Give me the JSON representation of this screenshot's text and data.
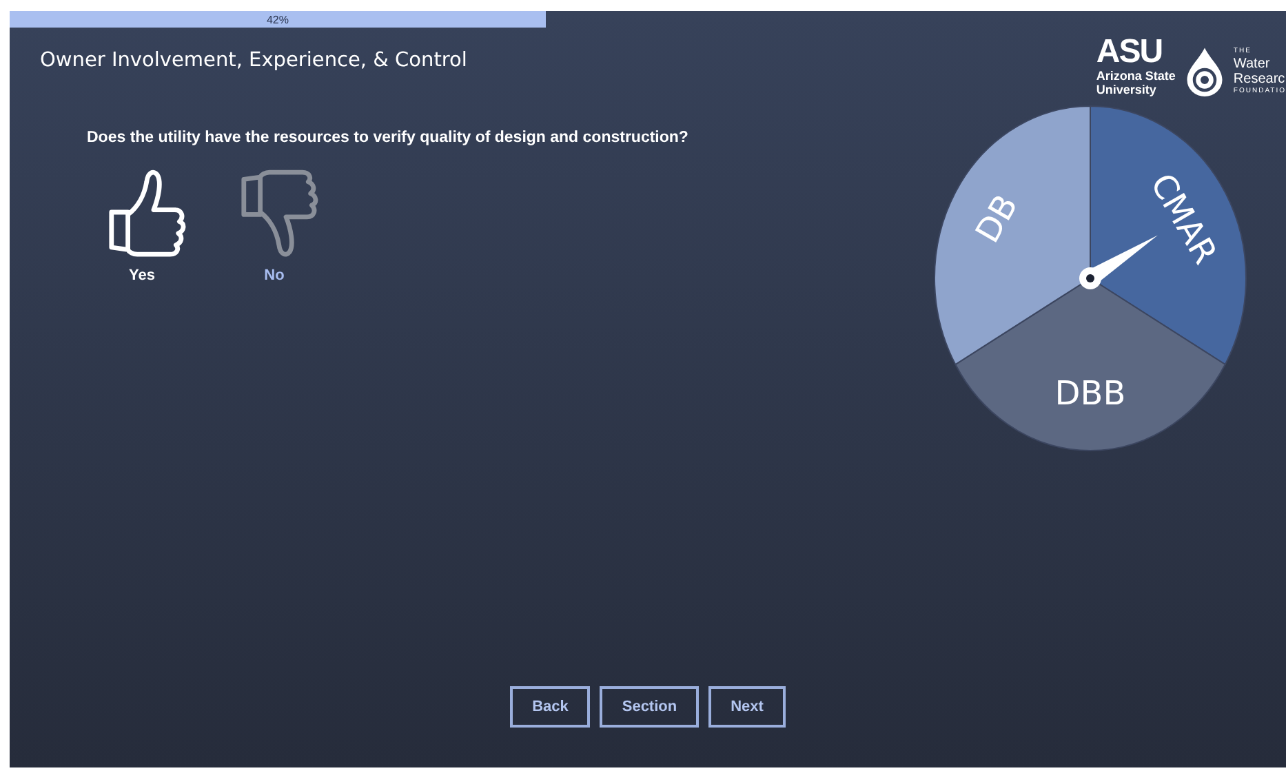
{
  "progress": {
    "label": "42%",
    "level": 0.42
  },
  "title": "Owner Involvement, Experience, & Control",
  "logos": {
    "asu": {
      "mark": "ASU",
      "line1": "Arizona State",
      "line2": "University"
    },
    "foundation": {
      "small": "THE",
      "line1": "Water",
      "line2": "Researc",
      "line3": "FOUNDATIO"
    }
  },
  "question": "Does the utility have the resources to verify quality of design and construction?",
  "answers": [
    {
      "label": "Yes",
      "kind": "up",
      "selected": true
    },
    {
      "label": "No",
      "kind": "down",
      "selected": false
    }
  ],
  "wheel": {
    "segments": [
      {
        "label": "CMAR",
        "color": "#46679f",
        "selected": true
      },
      {
        "label": "DBB",
        "color": "#5c6882",
        "selected": false
      },
      {
        "label": "DB",
        "color": "#8fa4cc",
        "selected": false
      }
    ]
  },
  "buttons": [
    "Back",
    "Section",
    "Next"
  ]
}
